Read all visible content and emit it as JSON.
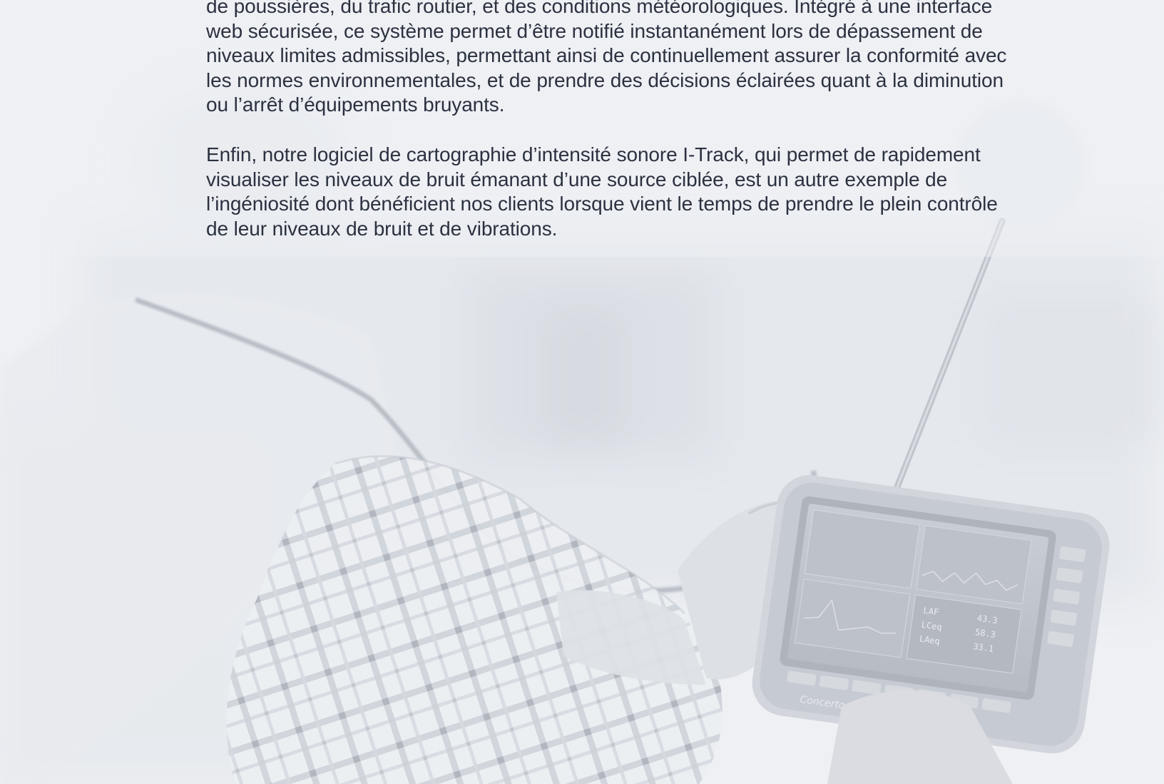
{
  "article": {
    "paragraphs": [
      "de poussières, du trafic routier, et des conditions météorologiques. Intégré à une interface web sécurisée, ce système permet d’être notifié instantanément lors de dépassement de niveaux limites admissibles, permettant ainsi de continuellement assurer la conformité avec les normes environnementales, et de prendre des décisions éclairées quant à la diminution ou l’arrêt d’équipements bruyants.",
      "Enfin, notre logiciel de cartographie d’intensité sonore I-Track, qui permet de rapidement visualiser les niveaux de bruit émanant d’une source ciblée, est un autre exemple de l’ingéniosité dont bénéficient nos clients lorsque vient le temps de prendre le plein contrôle de leur niveaux de bruit et de vibrations."
    ]
  },
  "background": {
    "image": "technician-holding-sound-level-meter-photo",
    "overlay_color": "#eef0f4",
    "device_brand_label": "Concerto",
    "screen_readouts": [
      {
        "label": "LAF",
        "value": "43.3"
      },
      {
        "label": "LCeq",
        "value": "58.3"
      },
      {
        "label": "LAeq",
        "value": "33.1"
      }
    ]
  }
}
